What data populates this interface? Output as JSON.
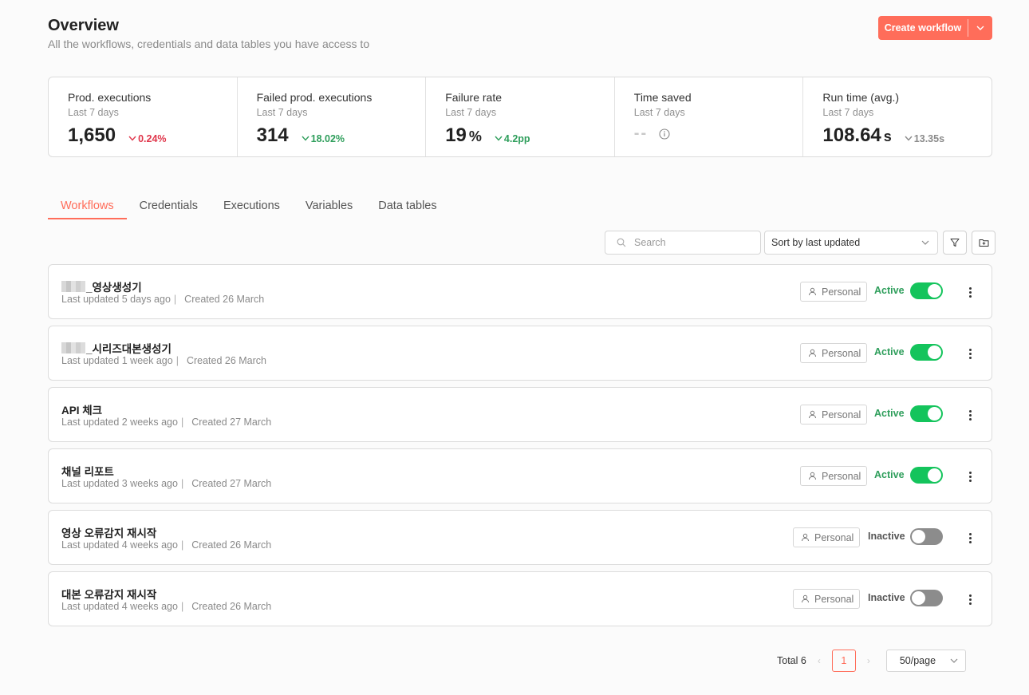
{
  "header": {
    "title": "Overview",
    "subtitle": "All the workflows, credentials and data tables you have access to",
    "create_label": "Create workflow"
  },
  "stats": [
    {
      "label": "Prod. executions",
      "period": "Last 7 days",
      "value": "1,650",
      "unit": "",
      "delta": "0.24%",
      "delta_color": "#e0364b"
    },
    {
      "label": "Failed prod. executions",
      "period": "Last 7 days",
      "value": "314",
      "unit": "",
      "delta": "18.02%",
      "delta_color": "#2e9e5b"
    },
    {
      "label": "Failure rate",
      "period": "Last 7 days",
      "value": "19",
      "unit": "%",
      "delta": "4.2pp",
      "delta_color": "#2e9e5b"
    },
    {
      "label": "Time saved",
      "period": "Last 7 days",
      "value": "--",
      "unit": "",
      "delta": "",
      "delta_color": "#8a8a8a"
    },
    {
      "label": "Run time (avg.)",
      "period": "Last 7 days",
      "value": "108.64",
      "unit": "s",
      "delta": "13.35s",
      "delta_color": "#8a8a8a"
    }
  ],
  "tabs": [
    {
      "label": "Workflows",
      "active": true
    },
    {
      "label": "Credentials",
      "active": false
    },
    {
      "label": "Executions",
      "active": false
    },
    {
      "label": "Variables",
      "active": false
    },
    {
      "label": "Data tables",
      "active": false
    }
  ],
  "toolbar": {
    "search_placeholder": "Search",
    "sort_value": "Sort by last updated"
  },
  "workflows": [
    {
      "name": "_영상생성기",
      "redacted_prefix": true,
      "updated": "Last updated 5 days ago",
      "created": "Created 26 March",
      "owner": "Personal",
      "status": "Active",
      "active": true
    },
    {
      "name": "_시리즈대본생성기",
      "redacted_prefix": true,
      "updated": "Last updated 1 week ago",
      "created": "Created 26 March",
      "owner": "Personal",
      "status": "Active",
      "active": true
    },
    {
      "name": "API 체크",
      "redacted_prefix": false,
      "updated": "Last updated 2 weeks ago",
      "created": "Created 27 March",
      "owner": "Personal",
      "status": "Active",
      "active": true
    },
    {
      "name": "채널 리포트",
      "redacted_prefix": false,
      "updated": "Last updated 3 weeks ago",
      "created": "Created 27 March",
      "owner": "Personal",
      "status": "Active",
      "active": true
    },
    {
      "name": "영상 오류감지 재시작",
      "redacted_prefix": false,
      "updated": "Last updated 4 weeks ago",
      "created": "Created 26 March",
      "owner": "Personal",
      "status": "Inactive",
      "active": false
    },
    {
      "name": "대본 오류감지 재시작",
      "redacted_prefix": false,
      "updated": "Last updated 4 weeks ago",
      "created": "Created 26 March",
      "owner": "Personal",
      "status": "Inactive",
      "active": false
    }
  ],
  "pagination": {
    "total": "Total 6",
    "current_page": "1",
    "page_size": "50/page"
  },
  "colors": {
    "accent": "#ff6d5a",
    "active_toggle": "#14c45c",
    "inactive_toggle": "#8c8c8c"
  }
}
